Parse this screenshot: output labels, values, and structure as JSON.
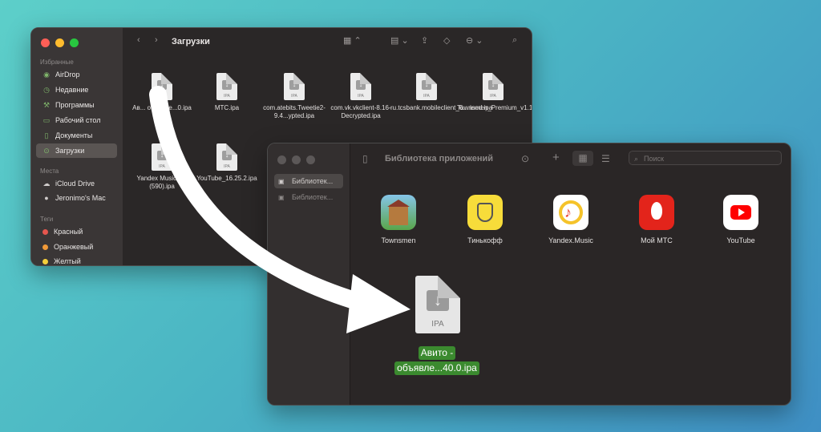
{
  "finder": {
    "title": "Загрузки",
    "sidebar": {
      "favorites_header": "Избранные",
      "favorites": [
        {
          "label": "AirDrop",
          "icon": "airdrop-icon"
        },
        {
          "label": "Недавние",
          "icon": "clock-icon"
        },
        {
          "label": "Программы",
          "icon": "applications-icon"
        },
        {
          "label": "Рабочий стол",
          "icon": "desktop-icon"
        },
        {
          "label": "Документы",
          "icon": "document-icon"
        },
        {
          "label": "Загрузки",
          "icon": "download-icon",
          "selected": true
        }
      ],
      "places_header": "Места",
      "places": [
        {
          "label": "iCloud Drive",
          "icon": "cloud-icon"
        },
        {
          "label": "Jeronimo's Mac",
          "icon": "apple-icon"
        }
      ],
      "tags_header": "Теги",
      "tags": [
        {
          "label": "Красный",
          "color": "#e5564e"
        },
        {
          "label": "Оранжевый",
          "color": "#f19a38"
        },
        {
          "label": "Желтый",
          "color": "#f5cf3b"
        }
      ]
    },
    "files": [
      {
        "name": "Ав... объявле...0.ipa"
      },
      {
        "name": "МТС.ipa"
      },
      {
        "name": "com.atebits.Tweetie2-9.4...ypted.ipa"
      },
      {
        "name": "com.vk.vkclient-8.16-Decrypted.ipa"
      },
      {
        "name": "ru.tcsbank.mobileclient_6....ined.ipa"
      },
      {
        "name": "Townsmen_Premium_v1.1...p.ru_.ipa"
      },
      {
        "name": "Yandex Music.r....(590).ipa"
      },
      {
        "name": "YouTube_16.25.2.ipa"
      }
    ],
    "file_icon_label": "IPA"
  },
  "library": {
    "title": "Библиотека приложений",
    "search_placeholder": "Поиск",
    "sidebar": [
      {
        "label": "Библиотек...",
        "selected": true
      },
      {
        "label": "Библиотек..."
      }
    ],
    "apps": [
      {
        "name": "Townsmen",
        "icon": "townsmen-icon"
      },
      {
        "name": "Тинькофф",
        "icon": "tinkoff-icon"
      },
      {
        "name": "Yandex.Music",
        "icon": "yandex-music-icon"
      },
      {
        "name": "Мой МТС",
        "icon": "mts-icon"
      },
      {
        "name": "YouTube",
        "icon": "youtube-icon"
      }
    ],
    "dragged_file": {
      "icon_label": "IPA",
      "line1": "Авито -",
      "line2": "объявле...40.0.ipa"
    }
  },
  "colors": {
    "traffic_red": "#ff5f57",
    "traffic_yellow": "#febc2e",
    "traffic_green": "#28c840",
    "selection_green": "#3b8a2f"
  }
}
